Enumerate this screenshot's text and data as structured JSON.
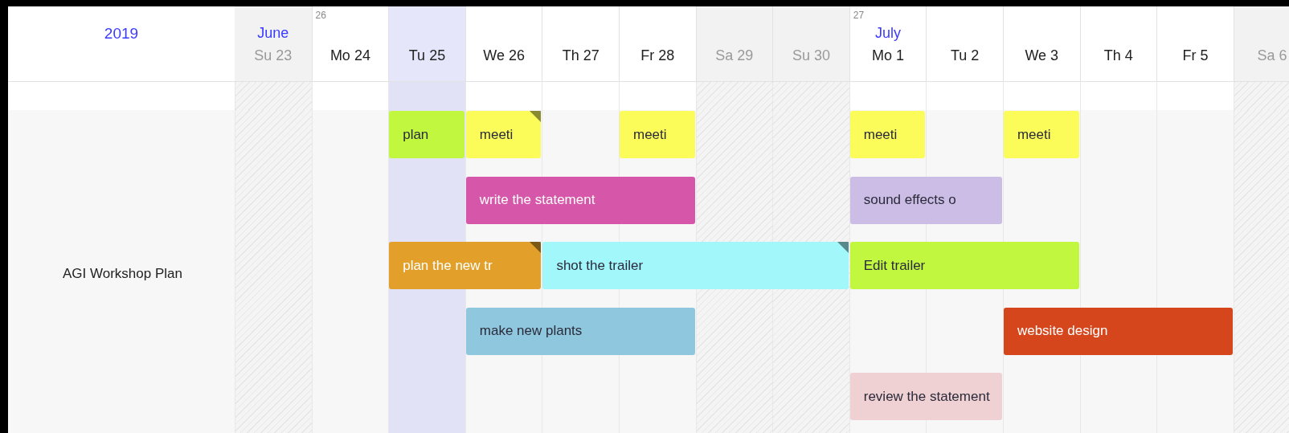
{
  "year": "2019",
  "days": [
    {
      "label": "Su 23",
      "kind": "weekend",
      "selected": false,
      "month": "June"
    },
    {
      "label": "Mo 24",
      "kind": "weekday",
      "selected": false,
      "week": "26"
    },
    {
      "label": "Tu 25",
      "kind": "weekday",
      "selected": true
    },
    {
      "label": "We 26",
      "kind": "weekday",
      "selected": false
    },
    {
      "label": "Th 27",
      "kind": "weekday",
      "selected": false
    },
    {
      "label": "Fr 28",
      "kind": "weekday",
      "selected": false
    },
    {
      "label": "Sa 29",
      "kind": "weekend",
      "selected": false
    },
    {
      "label": "Su 30",
      "kind": "weekend",
      "selected": false
    },
    {
      "label": "Mo 1",
      "kind": "weekday",
      "selected": false,
      "week": "27",
      "month": "July"
    },
    {
      "label": "Tu 2",
      "kind": "weekday",
      "selected": false
    },
    {
      "label": "We 3",
      "kind": "weekday",
      "selected": false
    },
    {
      "label": "Th 4",
      "kind": "weekday",
      "selected": false
    },
    {
      "label": "Fr 5",
      "kind": "weekday",
      "selected": false
    },
    {
      "label": "Sa 6",
      "kind": "weekend",
      "selected": false
    }
  ],
  "resource": "AGI Workshop Plan",
  "lanes": [
    [
      {
        "kind": "empty"
      },
      {
        "kind": "empty"
      },
      {
        "kind": "event",
        "label": "plan",
        "color": "#c1f73f",
        "flagged": false
      },
      {
        "kind": "event",
        "label": "meeti",
        "color": "#fbfc5a",
        "flagged": true
      },
      {
        "kind": "empty"
      },
      {
        "kind": "event",
        "label": "meeti",
        "color": "#fbfc5a",
        "flagged": false
      },
      {
        "kind": "empty"
      },
      {
        "kind": "empty"
      },
      {
        "kind": "event",
        "label": "meeti",
        "color": "#fbfc5a",
        "flagged": false
      },
      {
        "kind": "empty"
      },
      {
        "kind": "event",
        "label": "meeti",
        "color": "#fbfc5a",
        "flagged": false
      },
      {
        "kind": "empty"
      },
      {
        "kind": "empty"
      },
      {
        "kind": "empty"
      }
    ],
    [
      {
        "kind": "empty"
      },
      {
        "kind": "empty"
      },
      {
        "kind": "empty"
      },
      {
        "kind": "event",
        "label": "write the statement",
        "color": "#d656a9",
        "flagged": false
      },
      {
        "kind": "more"
      },
      {
        "kind": "more"
      },
      {
        "kind": "empty"
      },
      {
        "kind": "empty"
      },
      {
        "kind": "event",
        "label": "sound effects o",
        "color": "#cbbde6",
        "flagged": false
      },
      {
        "kind": "more"
      },
      {
        "kind": "empty"
      },
      {
        "kind": "empty"
      },
      {
        "kind": "empty"
      },
      {
        "kind": "empty"
      }
    ],
    [
      {
        "kind": "empty"
      },
      {
        "kind": "empty"
      },
      {
        "kind": "event",
        "label": "plan the new tr",
        "color": "#e2a02a",
        "flagged": true
      },
      {
        "kind": "more"
      },
      {
        "kind": "event",
        "label": "shot the trailer",
        "color": "#a2f7fb",
        "flagged": true
      },
      {
        "kind": "more"
      },
      {
        "kind": "more"
      },
      {
        "kind": "more"
      },
      {
        "kind": "event",
        "label": "Edit trailer",
        "color": "#c1f73f",
        "flagged": false
      },
      {
        "kind": "more"
      },
      {
        "kind": "more"
      },
      {
        "kind": "empty"
      },
      {
        "kind": "empty"
      },
      {
        "kind": "empty"
      }
    ],
    [
      {
        "kind": "empty"
      },
      {
        "kind": "empty"
      },
      {
        "kind": "empty"
      },
      {
        "kind": "event",
        "label": "make new plants",
        "color": "#8fc8de",
        "flagged": false
      },
      {
        "kind": "more"
      },
      {
        "kind": "more"
      },
      {
        "kind": "empty"
      },
      {
        "kind": "empty"
      },
      {
        "kind": "empty"
      },
      {
        "kind": "empty"
      },
      {
        "kind": "event",
        "label": "website design",
        "color": "#d6461c",
        "flagged": false
      },
      {
        "kind": "more"
      },
      {
        "kind": "more"
      },
      {
        "kind": "empty"
      }
    ],
    [
      {
        "kind": "empty"
      },
      {
        "kind": "empty"
      },
      {
        "kind": "empty"
      },
      {
        "kind": "empty"
      },
      {
        "kind": "empty"
      },
      {
        "kind": "empty"
      },
      {
        "kind": "empty"
      },
      {
        "kind": "empty"
      },
      {
        "kind": "event",
        "label": "review the statement",
        "color": "#efd0d3",
        "flagged": false
      },
      {
        "kind": "more"
      },
      {
        "kind": "empty"
      },
      {
        "kind": "empty"
      },
      {
        "kind": "empty"
      },
      {
        "kind": "empty"
      }
    ]
  ]
}
